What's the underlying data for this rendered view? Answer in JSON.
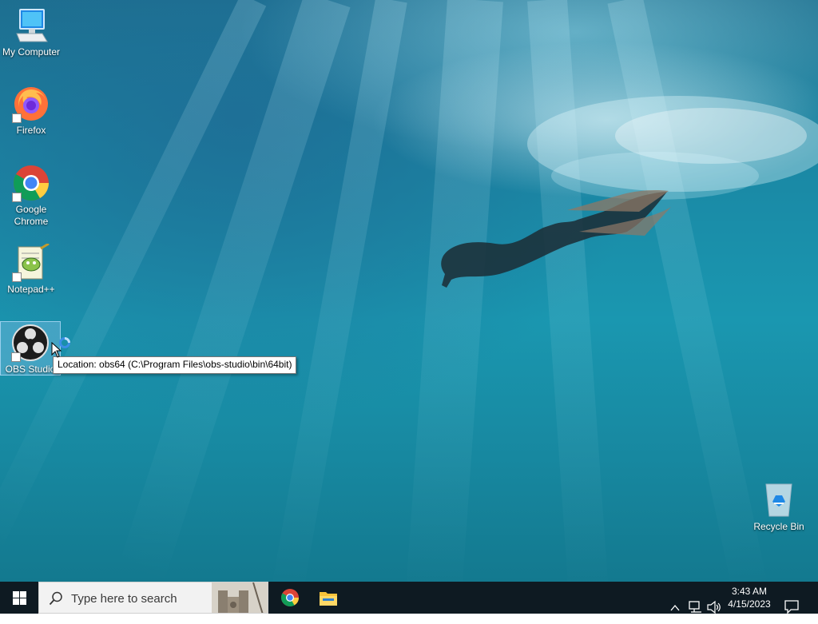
{
  "desktop_icons": [
    {
      "label": "My Computer",
      "icon": "computer-icon",
      "shortcut": false
    },
    {
      "label": "Firefox",
      "icon": "firefox-icon",
      "shortcut": true
    },
    {
      "label": "Google Chrome",
      "icon": "chrome-icon",
      "shortcut": true
    },
    {
      "label": "Notepad++",
      "icon": "notepadplusplus-icon",
      "shortcut": true
    },
    {
      "label": "OBS Studio",
      "icon": "obs-icon",
      "shortcut": true,
      "selected": true
    }
  ],
  "recycle_bin": {
    "label": "Recycle Bin",
    "icon": "recycle-bin-icon"
  },
  "tooltip": {
    "text": "Location: obs64 (C:\\Program Files\\obs-studio\\bin\\64bit)"
  },
  "taskbar": {
    "start_icon": "windows-logo-icon",
    "search": {
      "placeholder": "Type here to search",
      "icon": "search-icon"
    },
    "pinned": [
      {
        "name": "Google Chrome",
        "icon": "chrome-icon"
      },
      {
        "name": "File Explorer",
        "icon": "folder-icon"
      }
    ],
    "tray_icons": [
      "chevron-up-icon",
      "network-icon",
      "volume-icon"
    ],
    "clock": {
      "time": "3:43 AM",
      "date": "4/15/2023"
    },
    "notification_icon": "notification-icon"
  },
  "colors": {
    "taskbar_bg": "#0e1a22",
    "search_bg": "#f2f2f2",
    "water_top": "#1d6f8e",
    "water_bottom": "#13798f"
  }
}
